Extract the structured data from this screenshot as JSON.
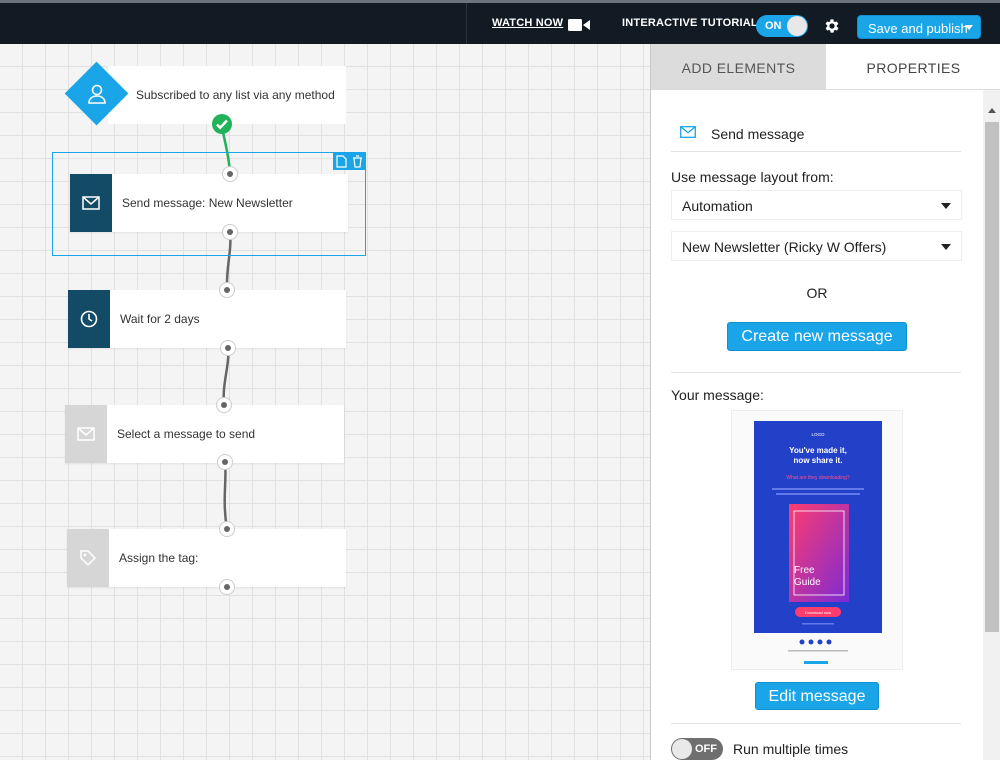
{
  "topbar": {
    "watch_label": "WATCH NOW",
    "tutorial_label": "INTERACTIVE TUTORIAL",
    "tutorial_toggle": "ON",
    "publish_label": "Save and publish",
    "accent": "#1aa5e8"
  },
  "workflow": {
    "trigger": "Subscribed to any list via any method",
    "nodes": [
      {
        "label": "Send message: New Newsletter",
        "icon": "envelope-icon"
      },
      {
        "label": "Wait for 2 days",
        "icon": "clock-icon"
      },
      {
        "label": "Select a message to send",
        "icon": "envelope-icon"
      },
      {
        "label": "Assign the tag:",
        "icon": "tag-icon"
      }
    ]
  },
  "panel": {
    "tabs": {
      "add": "ADD ELEMENTS",
      "properties": "PROPERTIES"
    },
    "title": "Send message",
    "layout_label": "Use message layout from:",
    "layout_select": "Automation",
    "message_select": "New Newsletter (Ricky W Offers)",
    "or_text": "OR",
    "create_button": "Create new message",
    "your_message_label": "Your message:",
    "edit_button": "Edit message",
    "run_toggle": "OFF",
    "run_label": "Run multiple times",
    "preview": {
      "logo": "LOGO",
      "headline_1": "You've made it,",
      "headline_2": "now share it.",
      "subhead": "What are they downloading?",
      "guide_1": "Free",
      "guide_2": "Guide",
      "cta": "Download now"
    }
  }
}
